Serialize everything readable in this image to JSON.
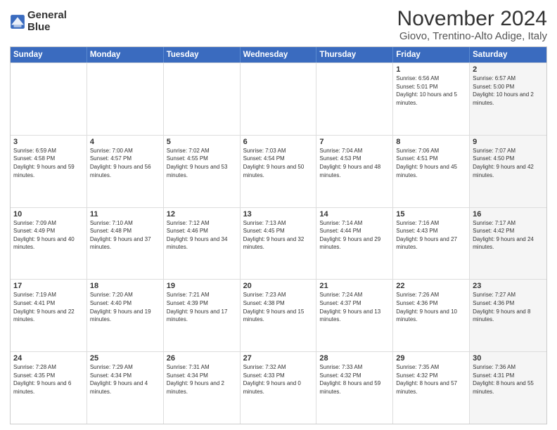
{
  "logo": {
    "line1": "General",
    "line2": "Blue"
  },
  "title": "November 2024",
  "subtitle": "Giovo, Trentino-Alto Adige, Italy",
  "headers": [
    "Sunday",
    "Monday",
    "Tuesday",
    "Wednesday",
    "Thursday",
    "Friday",
    "Saturday"
  ],
  "rows": [
    [
      {
        "day": "",
        "info": "",
        "shaded": false
      },
      {
        "day": "",
        "info": "",
        "shaded": false
      },
      {
        "day": "",
        "info": "",
        "shaded": false
      },
      {
        "day": "",
        "info": "",
        "shaded": false
      },
      {
        "day": "",
        "info": "",
        "shaded": false
      },
      {
        "day": "1",
        "info": "Sunrise: 6:56 AM\nSunset: 5:01 PM\nDaylight: 10 hours and 5 minutes.",
        "shaded": false
      },
      {
        "day": "2",
        "info": "Sunrise: 6:57 AM\nSunset: 5:00 PM\nDaylight: 10 hours and 2 minutes.",
        "shaded": true
      }
    ],
    [
      {
        "day": "3",
        "info": "Sunrise: 6:59 AM\nSunset: 4:58 PM\nDaylight: 9 hours and 59 minutes.",
        "shaded": false
      },
      {
        "day": "4",
        "info": "Sunrise: 7:00 AM\nSunset: 4:57 PM\nDaylight: 9 hours and 56 minutes.",
        "shaded": false
      },
      {
        "day": "5",
        "info": "Sunrise: 7:02 AM\nSunset: 4:55 PM\nDaylight: 9 hours and 53 minutes.",
        "shaded": false
      },
      {
        "day": "6",
        "info": "Sunrise: 7:03 AM\nSunset: 4:54 PM\nDaylight: 9 hours and 50 minutes.",
        "shaded": false
      },
      {
        "day": "7",
        "info": "Sunrise: 7:04 AM\nSunset: 4:53 PM\nDaylight: 9 hours and 48 minutes.",
        "shaded": false
      },
      {
        "day": "8",
        "info": "Sunrise: 7:06 AM\nSunset: 4:51 PM\nDaylight: 9 hours and 45 minutes.",
        "shaded": false
      },
      {
        "day": "9",
        "info": "Sunrise: 7:07 AM\nSunset: 4:50 PM\nDaylight: 9 hours and 42 minutes.",
        "shaded": true
      }
    ],
    [
      {
        "day": "10",
        "info": "Sunrise: 7:09 AM\nSunset: 4:49 PM\nDaylight: 9 hours and 40 minutes.",
        "shaded": false
      },
      {
        "day": "11",
        "info": "Sunrise: 7:10 AM\nSunset: 4:48 PM\nDaylight: 9 hours and 37 minutes.",
        "shaded": false
      },
      {
        "day": "12",
        "info": "Sunrise: 7:12 AM\nSunset: 4:46 PM\nDaylight: 9 hours and 34 minutes.",
        "shaded": false
      },
      {
        "day": "13",
        "info": "Sunrise: 7:13 AM\nSunset: 4:45 PM\nDaylight: 9 hours and 32 minutes.",
        "shaded": false
      },
      {
        "day": "14",
        "info": "Sunrise: 7:14 AM\nSunset: 4:44 PM\nDaylight: 9 hours and 29 minutes.",
        "shaded": false
      },
      {
        "day": "15",
        "info": "Sunrise: 7:16 AM\nSunset: 4:43 PM\nDaylight: 9 hours and 27 minutes.",
        "shaded": false
      },
      {
        "day": "16",
        "info": "Sunrise: 7:17 AM\nSunset: 4:42 PM\nDaylight: 9 hours and 24 minutes.",
        "shaded": true
      }
    ],
    [
      {
        "day": "17",
        "info": "Sunrise: 7:19 AM\nSunset: 4:41 PM\nDaylight: 9 hours and 22 minutes.",
        "shaded": false
      },
      {
        "day": "18",
        "info": "Sunrise: 7:20 AM\nSunset: 4:40 PM\nDaylight: 9 hours and 19 minutes.",
        "shaded": false
      },
      {
        "day": "19",
        "info": "Sunrise: 7:21 AM\nSunset: 4:39 PM\nDaylight: 9 hours and 17 minutes.",
        "shaded": false
      },
      {
        "day": "20",
        "info": "Sunrise: 7:23 AM\nSunset: 4:38 PM\nDaylight: 9 hours and 15 minutes.",
        "shaded": false
      },
      {
        "day": "21",
        "info": "Sunrise: 7:24 AM\nSunset: 4:37 PM\nDaylight: 9 hours and 13 minutes.",
        "shaded": false
      },
      {
        "day": "22",
        "info": "Sunrise: 7:26 AM\nSunset: 4:36 PM\nDaylight: 9 hours and 10 minutes.",
        "shaded": false
      },
      {
        "day": "23",
        "info": "Sunrise: 7:27 AM\nSunset: 4:36 PM\nDaylight: 9 hours and 8 minutes.",
        "shaded": true
      }
    ],
    [
      {
        "day": "24",
        "info": "Sunrise: 7:28 AM\nSunset: 4:35 PM\nDaylight: 9 hours and 6 minutes.",
        "shaded": false
      },
      {
        "day": "25",
        "info": "Sunrise: 7:29 AM\nSunset: 4:34 PM\nDaylight: 9 hours and 4 minutes.",
        "shaded": false
      },
      {
        "day": "26",
        "info": "Sunrise: 7:31 AM\nSunset: 4:34 PM\nDaylight: 9 hours and 2 minutes.",
        "shaded": false
      },
      {
        "day": "27",
        "info": "Sunrise: 7:32 AM\nSunset: 4:33 PM\nDaylight: 9 hours and 0 minutes.",
        "shaded": false
      },
      {
        "day": "28",
        "info": "Sunrise: 7:33 AM\nSunset: 4:32 PM\nDaylight: 8 hours and 59 minutes.",
        "shaded": false
      },
      {
        "day": "29",
        "info": "Sunrise: 7:35 AM\nSunset: 4:32 PM\nDaylight: 8 hours and 57 minutes.",
        "shaded": false
      },
      {
        "day": "30",
        "info": "Sunrise: 7:36 AM\nSunset: 4:31 PM\nDaylight: 8 hours and 55 minutes.",
        "shaded": true
      }
    ]
  ]
}
